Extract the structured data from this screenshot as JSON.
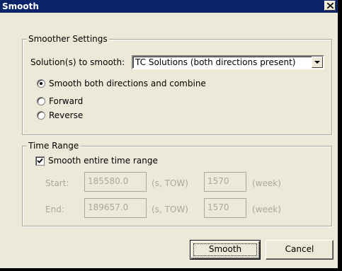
{
  "window": {
    "title": "Smooth",
    "close_glyph": "close-icon"
  },
  "smoother": {
    "group_label": "Smoother Settings",
    "solutions_label": "Solution(s) to smooth:",
    "solutions_value": "TC Solutions (both directions present)",
    "options": [
      {
        "label": "Smooth both directions and combine",
        "selected": true
      },
      {
        "label": "Forward",
        "selected": false
      },
      {
        "label": "Reverse",
        "selected": false
      }
    ]
  },
  "time_range": {
    "group_label": "Time Range",
    "entire_label": "Smooth entire time range",
    "entire_checked": true,
    "start": {
      "label": "Start:",
      "seconds_value": "185580.0",
      "seconds_unit": "(s, TOW)",
      "week_value": "1570",
      "week_unit": "(week)"
    },
    "end": {
      "label": "End:",
      "seconds_value": "189657.0",
      "seconds_unit": "(s, TOW)",
      "week_value": "1570",
      "week_unit": "(week)"
    }
  },
  "buttons": {
    "smooth_label": "Smooth",
    "cancel_label": "Cancel"
  },
  "colors": {
    "titlebar": "#0a246a",
    "face": "#ece9d8",
    "disabled_text": "#aca899"
  }
}
